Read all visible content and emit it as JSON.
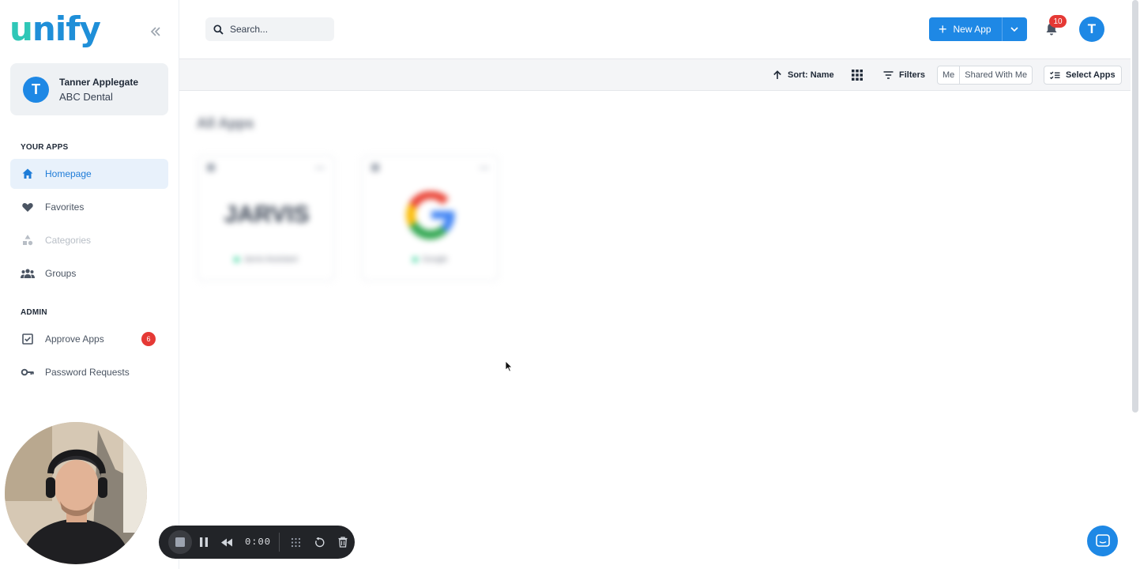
{
  "brand": {
    "logo_u": "u",
    "logo_rest": "nify"
  },
  "user": {
    "initial": "T",
    "name": "Tanner Applegate",
    "org": "ABC Dental"
  },
  "sidebar": {
    "your_apps_label": "YOUR APPS",
    "your_apps": [
      {
        "label": "Homepage",
        "icon": "home-icon",
        "active": true
      },
      {
        "label": "Favorites",
        "icon": "heart-icon"
      },
      {
        "label": "Categories",
        "icon": "shapes-icon",
        "disabled": true
      },
      {
        "label": "Groups",
        "icon": "groups-icon"
      }
    ],
    "admin_label": "ADMIN",
    "admin": [
      {
        "label": "Approve Apps",
        "icon": "checkbox-icon",
        "badge": "6"
      },
      {
        "label": "Password Requests",
        "icon": "key-icon"
      }
    ]
  },
  "topbar": {
    "search_placeholder": "Search...",
    "new_app_label": "New App",
    "notifications_count": "10",
    "avatar_initial": "T"
  },
  "toolbar": {
    "sort_label": "Sort: Name",
    "filters_label": "Filters",
    "owner_options": [
      "Me",
      "Shared With Me"
    ],
    "select_apps_label": "Select Apps"
  },
  "content": {
    "title": "All Apps",
    "cards": [
      {
        "logo_text": "JARVIS",
        "label": "Jarvis Assistant"
      },
      {
        "logo_text": "G",
        "label": "Google"
      }
    ]
  },
  "recorder": {
    "time": "0:00"
  },
  "colors": {
    "primary": "#1e88e5",
    "badge": "#e53935",
    "logo_teal": "#2fc7b7"
  }
}
